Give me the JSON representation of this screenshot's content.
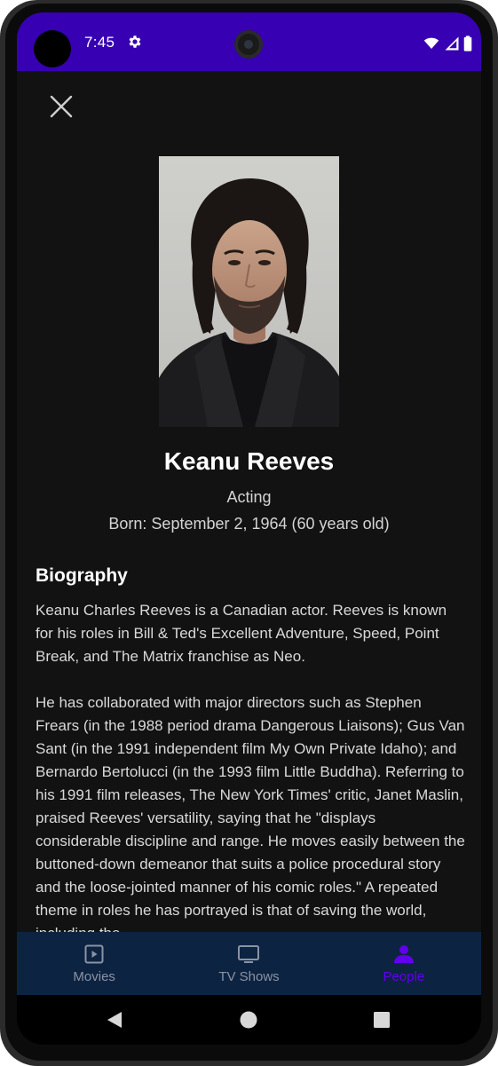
{
  "status_bar": {
    "time": "7:45",
    "icons": [
      "settings-icon",
      "wifi-icon",
      "signal-icon",
      "battery-icon"
    ],
    "background": "#3700b3"
  },
  "person": {
    "name": "Keanu Reeves",
    "department": "Acting",
    "born": "Born: September 2, 1964 (60 years old)",
    "photo_alt": "Keanu Reeves"
  },
  "biography": {
    "heading": "Biography",
    "text": "Keanu Charles Reeves is a Canadian actor. Reeves is known for his roles in Bill & Ted's Excellent Adventure, Speed, Point Break, and The Matrix franchise as Neo.\n\nHe has collaborated with major directors such as Stephen Frears (in the 1988 period drama Dangerous Liaisons); Gus Van Sant (in the 1991 independent film My Own Private Idaho); and Bernardo Bertolucci (in the 1993 film Little Buddha). Referring to his 1991 film releases, The New York Times' critic, Janet Maslin, praised Reeves' versatility, saying that he \"displays considerable discipline and range. He moves easily between the buttoned-down demeanor that suits a police procedural story and the loose-jointed manner of his comic roles.\" A repeated theme in roles he has portrayed is that of saving the world, including the"
  },
  "bottom_nav": {
    "items": [
      {
        "label": "Movies",
        "icon": "movie-icon",
        "active": false
      },
      {
        "label": "TV Shows",
        "icon": "tv-icon",
        "active": false
      },
      {
        "label": "People",
        "icon": "person-icon",
        "active": true
      }
    ],
    "background": "#0d2342",
    "active_color": "#6200ee",
    "inactive_color": "#8a93a3"
  },
  "system_nav": {
    "buttons": [
      "back-icon",
      "home-icon",
      "recents-icon"
    ]
  }
}
